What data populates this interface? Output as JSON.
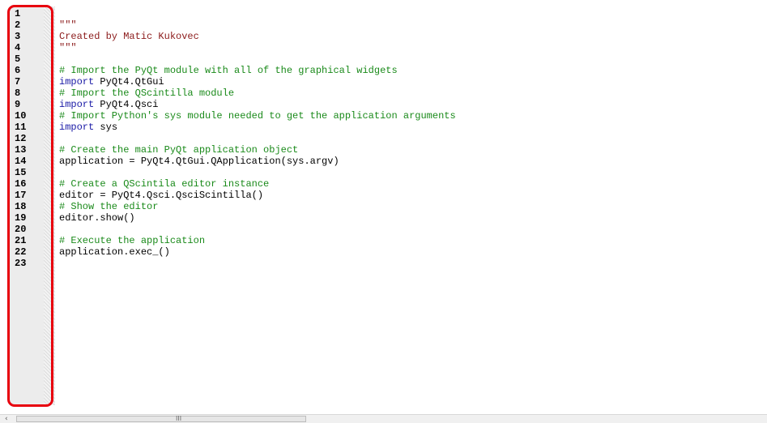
{
  "line_numbers": [
    "1",
    "2",
    "3",
    "4",
    "5",
    "6",
    "7",
    "8",
    "9",
    "10",
    "11",
    "12",
    "13",
    "14",
    "15",
    "16",
    "17",
    "18",
    "19",
    "20",
    "21",
    "22",
    "23"
  ],
  "code_lines": [
    {
      "type": "plain",
      "text": ""
    },
    {
      "type": "string",
      "text": "\"\"\""
    },
    {
      "type": "string",
      "text": "Created by Matic Kukovec"
    },
    {
      "type": "string",
      "text": "\"\"\""
    },
    {
      "type": "plain",
      "text": ""
    },
    {
      "type": "comment",
      "text": "# Import the PyQt module with all of the graphical widgets"
    },
    {
      "type": "import",
      "kw": "import",
      "rest": " PyQt4.QtGui"
    },
    {
      "type": "comment",
      "text": "# Import the QScintilla module"
    },
    {
      "type": "import",
      "kw": "import",
      "rest": " PyQt4.Qsci"
    },
    {
      "type": "comment",
      "text": "# Import Python's sys module needed to get the application arguments"
    },
    {
      "type": "import",
      "kw": "import",
      "rest": " sys"
    },
    {
      "type": "plain",
      "text": ""
    },
    {
      "type": "comment",
      "text": "# Create the main PyQt application object"
    },
    {
      "type": "plain",
      "text": "application = PyQt4.QtGui.QApplication(sys.argv)"
    },
    {
      "type": "plain",
      "text": ""
    },
    {
      "type": "comment",
      "text": "# Create a QScintila editor instance"
    },
    {
      "type": "plain",
      "text": "editor = PyQt4.Qsci.QsciScintilla()"
    },
    {
      "type": "comment",
      "text": "# Show the editor"
    },
    {
      "type": "plain",
      "text": "editor.show()"
    },
    {
      "type": "plain",
      "text": ""
    },
    {
      "type": "comment",
      "text": "# Execute the application"
    },
    {
      "type": "plain",
      "text": "application.exec_()"
    },
    {
      "type": "plain",
      "text": ""
    }
  ],
  "scrollbar": {
    "left_arrow": "‹",
    "grip": "III"
  },
  "colors": {
    "comment": "#1a8a1a",
    "string": "#8b1a1a",
    "keyword": "#1a1aa6",
    "highlight": "#e8000e"
  }
}
